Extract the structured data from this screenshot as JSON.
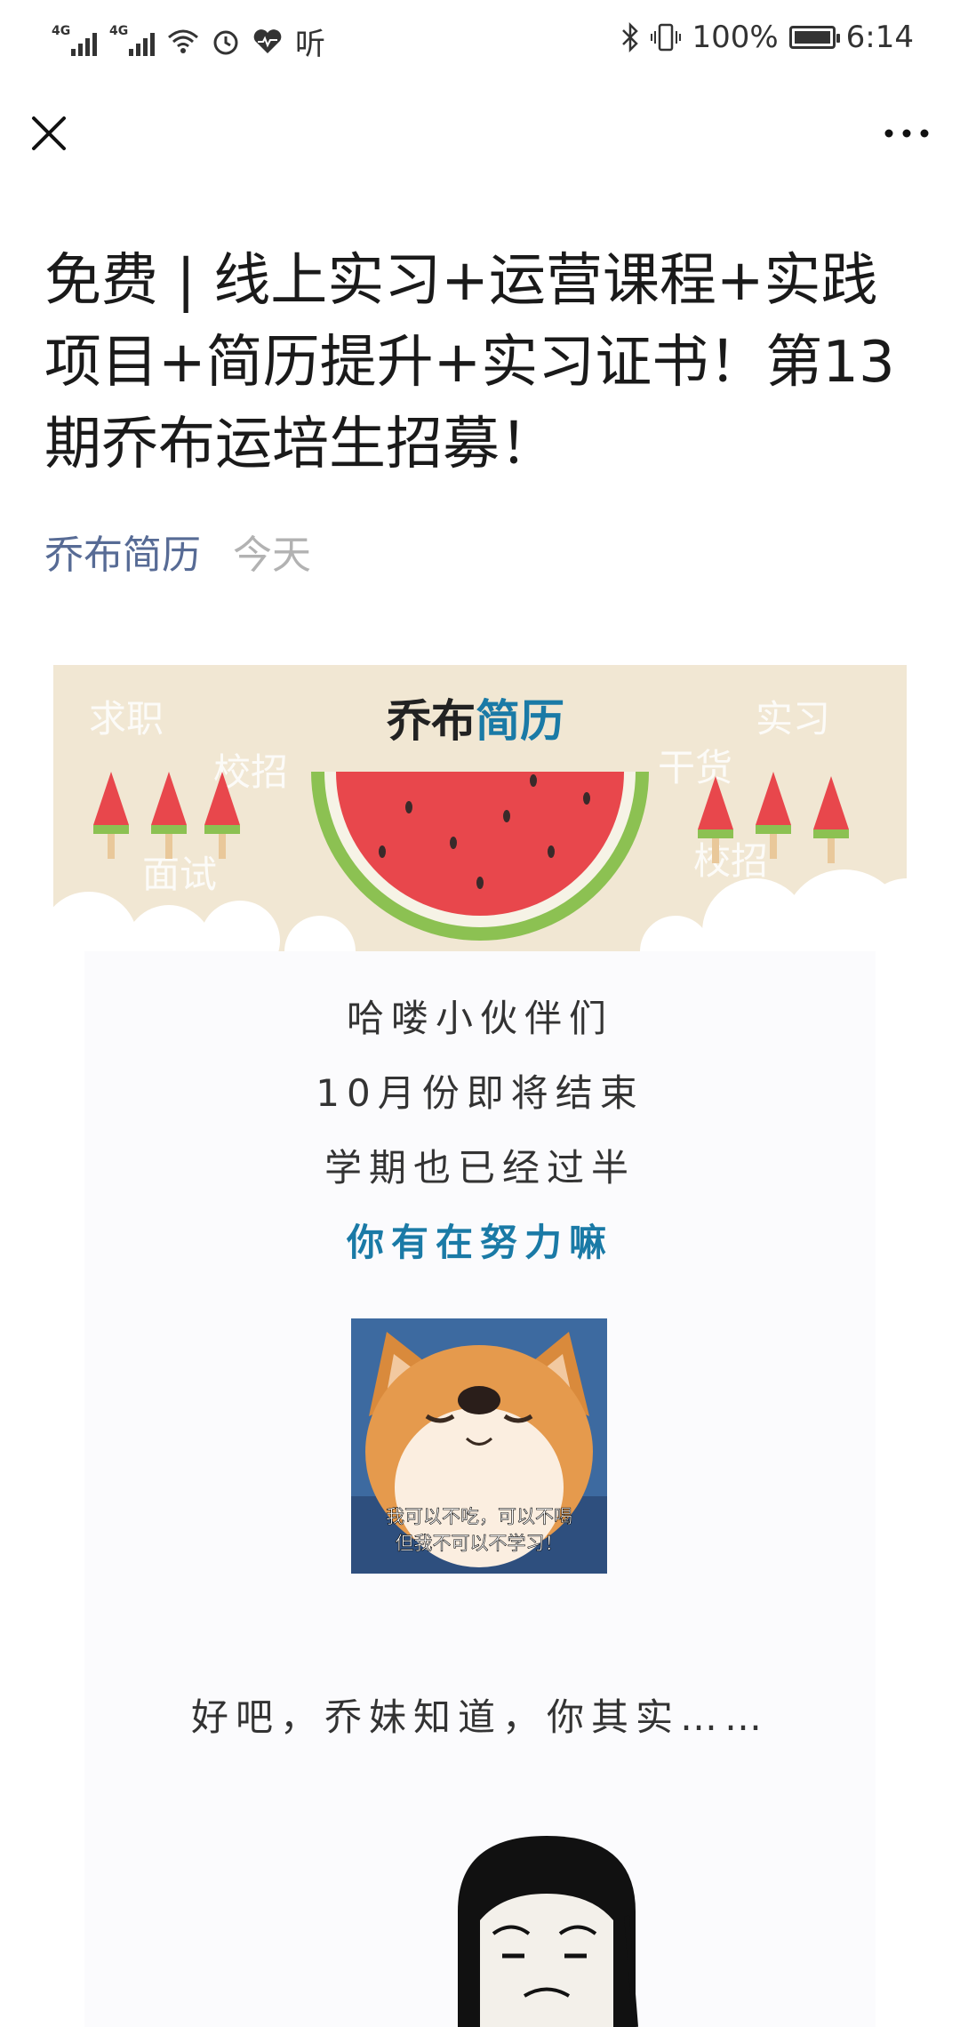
{
  "status_bar": {
    "network_1": "4G",
    "network_2": "4G",
    "battery_percent": "100%",
    "time": "6:14",
    "extra_label": "听"
  },
  "nav": {
    "close_icon": "close-icon",
    "more_icon": "more-horizontal-icon"
  },
  "article": {
    "title": "免费 | 线上实习+运营课程+实践项目+简历提升+实习证书！第13期乔布运培生招募！",
    "author": "乔布简历",
    "date": "今天"
  },
  "banner": {
    "logo_part1": "乔布",
    "logo_part2": "简历",
    "words": [
      "求职",
      "校招",
      "面试",
      "实习",
      "干货",
      "校招"
    ],
    "colors": {
      "accent": "#1a7aa6",
      "watermelon": "#e8474c",
      "rind": "#8cc152",
      "paper": "#f1e7d3"
    }
  },
  "body": {
    "lines": [
      "哈喽小伙伴们",
      "10月份即将结束",
      "学期也已经过半",
      "你有在努力嘛"
    ],
    "dog_caption_1": "我可以不吃，可以不喝",
    "dog_caption_2": "但我不可以不学习！",
    "after_text": "好吧，乔妹知道，你其实……"
  }
}
